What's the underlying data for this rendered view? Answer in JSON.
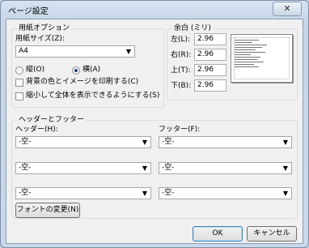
{
  "window": {
    "title": "ページ設定",
    "close": "✕"
  },
  "paper": {
    "group_label": "用紙オプション",
    "size_label": "用紙サイズ(Z):",
    "size_value": "A4",
    "portrait": "縦(O)",
    "landscape": "横(A)",
    "orientation_selected": "landscape",
    "print_bg": "背景の色とイメージを印刷する(C)",
    "shrink": "縮小して全体を表示できるようにする(S)"
  },
  "margins": {
    "group_label": "余白 (ミリ)",
    "left_label": "左(L):",
    "left": "2.96",
    "right_label": "右(R):",
    "right": "2.96",
    "top_label": "上(T):",
    "top": "2.96",
    "bottom_label": "下(B):",
    "bottom": "2.96"
  },
  "hf": {
    "group_label": "ヘッダーとフッター",
    "header_label": "ヘッダー(H):",
    "footer_label": "フッター(F):",
    "header1": "-空-",
    "header2": "-空-",
    "header3": "-空-",
    "footer1": "-空-",
    "footer2": "-空-",
    "footer3": "-空-",
    "font_button": "フォントの変更(N)"
  },
  "buttons": {
    "ok": "OK",
    "cancel": "キャンセル"
  }
}
